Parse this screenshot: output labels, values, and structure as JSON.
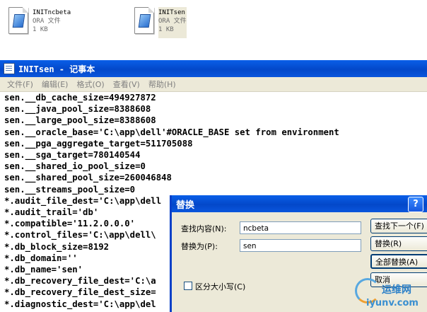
{
  "files": [
    {
      "name": "INITncbeta",
      "type": "ORA 文件",
      "size": "1 KB"
    },
    {
      "name": "INITsen",
      "type": "ORA 文件",
      "size": "1 KB"
    }
  ],
  "notepad": {
    "title": "INITsen - 记事本",
    "menu": [
      "文件(F)",
      "编辑(E)",
      "格式(O)",
      "查看(V)",
      "帮助(H)"
    ],
    "lines": [
      "sen.__db_cache_size=494927872",
      "sen.__java_pool_size=8388608",
      "sen.__large_pool_size=8388608",
      "sen.__oracle_base='C:\\app\\dell'#ORACLE_BASE set from environment",
      "sen.__pga_aggregate_target=511705088",
      "sen.__sga_target=780140544",
      "sen.__shared_io_pool_size=0",
      "sen.__shared_pool_size=260046848",
      "sen.__streams_pool_size=0",
      "*.audit_file_dest='C:\\app\\dell",
      "*.audit_trail='db'",
      "*.compatible='11.2.0.0.0'",
      "*.control_files='C:\\app\\dell\\",
      "*.db_block_size=8192",
      "*.db_domain=''",
      "*.db_name='sen'",
      "*.db_recovery_file_dest='C:\\a",
      "*.db_recovery_file_dest_size=",
      "*.diagnostic_dest='C:\\app\\del"
    ]
  },
  "dialog": {
    "title": "替换",
    "help": "?",
    "find_label": "查找内容(N):",
    "find_value": "ncbeta",
    "replace_label": "替换为(P):",
    "replace_value": "sen",
    "match_case_label": "区分大小写(C)",
    "buttons": {
      "find_next": "查找下一个(F)",
      "replace": "替换(R)",
      "replace_all": "全部替换(A)",
      "cancel": "取消"
    }
  },
  "watermark": {
    "cn": "运维网",
    "url": "iyunv.com"
  }
}
